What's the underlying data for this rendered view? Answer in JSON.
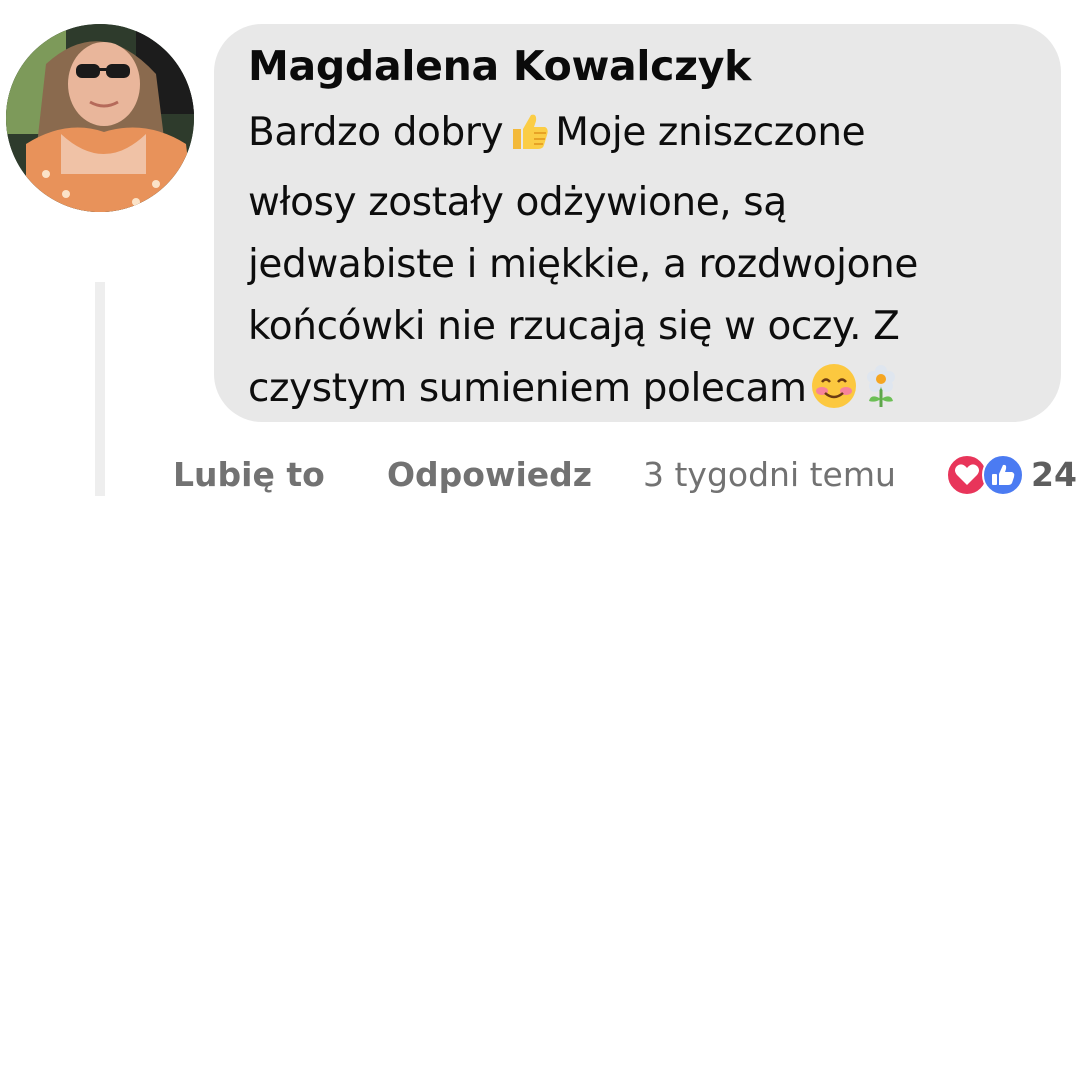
{
  "comment": {
    "author": "Magdalena Kowalczyk",
    "text_lines": [
      [
        "Bardzo dobry ",
        "thumbs-up-emoji",
        " Moje zniszczone"
      ],
      [
        "włosy zostały odżywione, są"
      ],
      [
        "jedwabiste i miękkie, a rozdwojone"
      ],
      [
        "końcówki nie rzucają się w oczy. Z"
      ],
      [
        "czystym sumieniem polecam ",
        "smiling-face-emoji",
        "flower-emoji"
      ]
    ],
    "line_1_before": "Bardzo dobry",
    "line_1_after": "Moje zniszczone",
    "line_2": "włosy zostały odżywione, są",
    "line_3": "jedwabiste i miękkie, a rozdwojone",
    "line_4": "końcówki nie rzucają się w oczy. Z",
    "line_5_before": "czystym sumieniem polecam"
  },
  "actions": {
    "like_label": "Lubię to",
    "reply_label": "Odpowiedz",
    "timestamp": "3 tygodni temu",
    "reaction_count": "24",
    "reaction_icons": [
      "heart-reaction-icon",
      "like-reaction-icon"
    ]
  },
  "colors": {
    "bubble_bg": "#e8e8e8",
    "action_text": "#727272",
    "heart_reaction": "#e8355a",
    "like_reaction": "#4b7bf2"
  }
}
